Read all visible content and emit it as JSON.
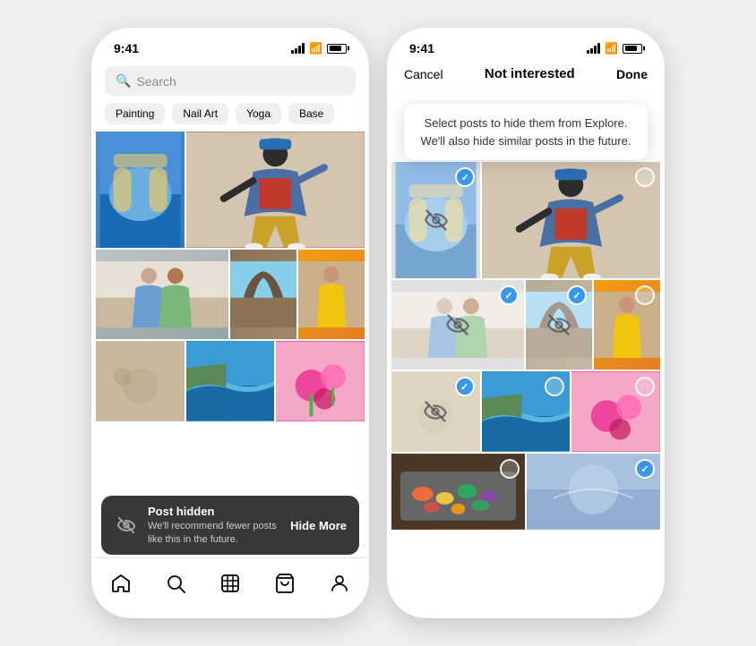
{
  "phone1": {
    "status": {
      "time": "9:41"
    },
    "search": {
      "placeholder": "Search"
    },
    "categories": [
      "Painting",
      "Nail Art",
      "Yoga",
      "Base"
    ],
    "snackbar": {
      "title": "Post hidden",
      "subtitle": "We'll recommend fewer posts\nlike this in the future.",
      "action": "Hide More"
    },
    "nav": {
      "items": [
        "home",
        "search",
        "reels",
        "shop",
        "profile"
      ]
    }
  },
  "phone2": {
    "status": {
      "time": "9:41"
    },
    "header": {
      "cancel": "Cancel",
      "title": "Not interested",
      "done": "Done"
    },
    "tooltip": "Select posts to hide them from Explore. We'll also hide similar posts in the future."
  }
}
